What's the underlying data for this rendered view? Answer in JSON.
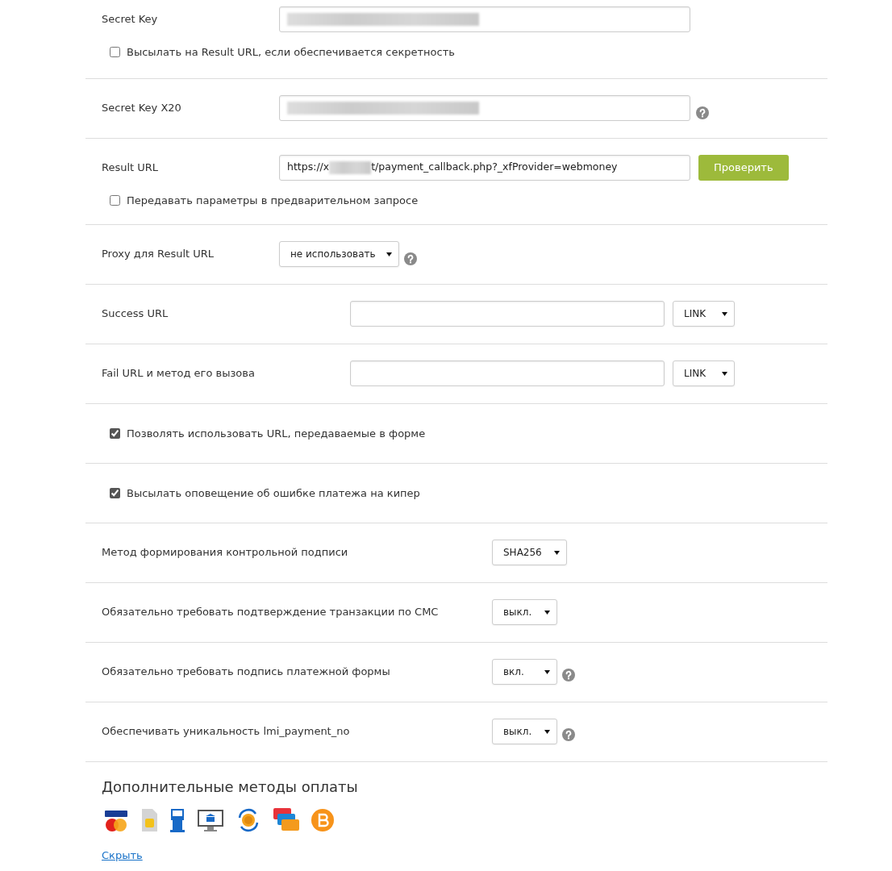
{
  "credentials": [
    {
      "kind": "field",
      "label": "Secret Key",
      "value_redacted": true,
      "help": false,
      "checkbox": {
        "label": "Высылать на Result URL, если обеспечивается секретность",
        "checked": false
      }
    },
    {
      "kind": "field",
      "label": "Secret Key X20",
      "value_redacted": true,
      "help": true
    },
    {
      "kind": "field",
      "label": "Result URL",
      "value": "https://x",
      "value_redacted": true,
      "value_after": "t/payment_callback.php?_xfProvider=webmoney",
      "button": "Проверить",
      "help": false,
      "checkbox": {
        "label": "Передавать параметры в предварительном запросе",
        "checked": false
      }
    },
    {
      "kind": "select",
      "label": "Proxy для Result URL",
      "value": "не использовать",
      "help": true
    }
  ],
  "redirect_urls": [
    {
      "label": "Success URL",
      "method": "LINK"
    },
    {
      "label": "Fail URL и метод его вызова",
      "method": "LINK"
    }
  ],
  "flags": [
    {
      "label": "Позволять использовать URL, передаваемые в форме",
      "checked": true
    },
    {
      "label": "Высылать оповещение об ошибке платежа на кипер",
      "checked": true
    }
  ],
  "options": [
    {
      "label": "Метод формирования контрольной подписи",
      "value": "SHA256",
      "help": false
    },
    {
      "label": "Обязательно требовать подтверждение транзакции по СМС",
      "value": "выкл.",
      "help": false
    },
    {
      "label": "Обязательно требовать подпись платежной формы",
      "value": "вкл.",
      "help": true
    },
    {
      "label": "Обеспечивать уникальность lmi_payment_no",
      "value": "выкл.",
      "help": true
    }
  ],
  "extra_methods": {
    "title": "Дополнительные методы оплаты",
    "toggle_link": "Скрыть"
  }
}
